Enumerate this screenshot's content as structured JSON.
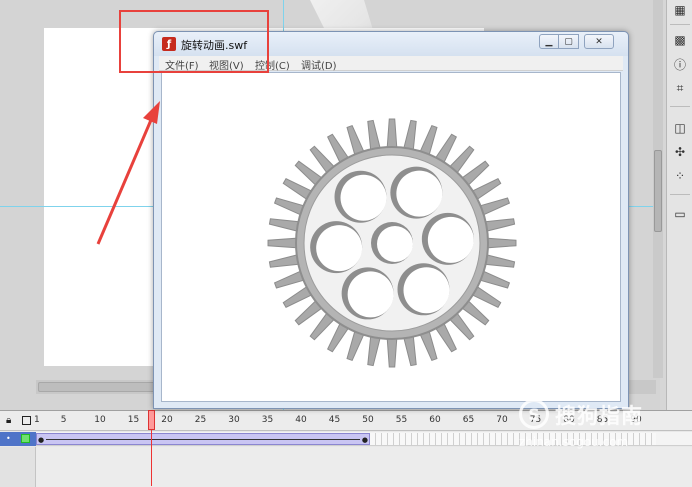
{
  "swf_window": {
    "title": "旋转动画.swf",
    "menu": [
      "文件(F)",
      "视图(V)",
      "控制(C)",
      "调试(D)"
    ],
    "icon": "flash-player-icon"
  },
  "timeline": {
    "ticks": [
      "1",
      "5",
      "10",
      "15",
      "20",
      "25",
      "30",
      "35",
      "40",
      "45",
      "50",
      "55",
      "60",
      "65",
      "70",
      "75",
      "80",
      "85",
      "90"
    ],
    "current_frame": 20
  },
  "watermark": {
    "logo": "S",
    "text": "搜狗指南",
    "url": "zhinan.sogou.com"
  },
  "colors": {
    "highlight": "#e8413c",
    "tween": "#c9c5f3",
    "gear": "#a9a9a9"
  },
  "icons": [
    "grid-icon",
    "info-icon",
    "transform-icon",
    "library-icon",
    "components-icon",
    "motion-icon",
    "align-icon",
    "lock-icon",
    "outline-icon"
  ]
}
